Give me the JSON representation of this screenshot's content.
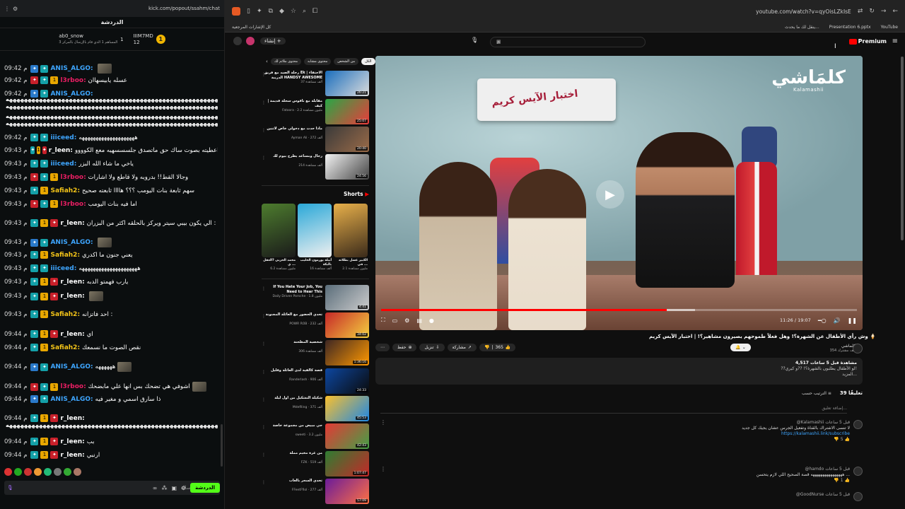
{
  "kick": {
    "url": "kick.com/popout/ssahm/chat",
    "header": "الدردشة",
    "leaders": [
      {
        "name": "IIIM7MD",
        "sub": "12",
        "coin": "1"
      },
      {
        "name": "ab0_snow",
        "sub": "1",
        "note": "المساهم 1 الذي قام بالإرسال بالمركز 3"
      }
    ],
    "messages": [
      {
        "time": "09:42 م",
        "user": "ANIS_ALGO:",
        "color": "#3ea6ff",
        "text": ""
      },
      {
        "time": "09:42 م",
        "user": "l3rboo:",
        "color": "#e91e63",
        "text": "عسله يابيسهاان"
      },
      {
        "time": "09:42 م",
        "user": "ANIS_ALGO:",
        "color": "#3ea6ff",
        "text": ""
      },
      {
        "time": "09:42 م",
        "user": "iiiceed:",
        "color": "#3ea6ff",
        "text": "ههههههههههههههههههههه"
      },
      {
        "time": "09:43 م",
        "user": "r_leen:",
        "color": "#ffffff",
        "text": "اعطيته بصوت ساك حق ماتصدق جلسسسهيه معع الكوووو"
      },
      {
        "time": "09:43 م",
        "user": "iiiceed:",
        "color": "#3ea6ff",
        "text": "ياخي ما شاء الله البزر"
      },
      {
        "time": "09:43 م",
        "user": "l3rboo:",
        "color": "#e91e63",
        "text": "وجالا القط!! بدروبه ولا قاطع ولا اشارات"
      },
      {
        "time": "09:43 م",
        "user": "Safiah2:",
        "color": "#f5c518",
        "text": "سهم ثابعة بنات اليومب ؟؟؟ هاااا ثابعته صحيح"
      },
      {
        "time": "09:43 م",
        "user": "l3rboo:",
        "color": "#e91e63",
        "text": "اما فيه بنات اليومب"
      },
      {
        "time": "09:43 م",
        "user": "r_leen:",
        "color": "#ffffff",
        "text": "الي يكون بيبي سيتر ويركز بالحلقه اكثر من البزران :"
      },
      {
        "time": "09:43 م",
        "user": "ANIS_ALGO:",
        "color": "#3ea6ff",
        "text": ""
      },
      {
        "time": "09:43 م",
        "user": "Safiah2:",
        "color": "#f5c518",
        "text": "يعني جنون ما اكدري"
      },
      {
        "time": "09:43 م",
        "user": "iiiceed:",
        "color": "#3ea6ff",
        "text": "هههههههههههههههههههههه"
      },
      {
        "time": "09:43 م",
        "user": "r_leen:",
        "color": "#ffffff",
        "text": "يارب فهمتو الدبه"
      },
      {
        "time": "09:43 م",
        "user": "r_leen:",
        "color": "#ffffff",
        "text": ""
      },
      {
        "time": "09:43 م",
        "user": "Safiah2:",
        "color": "#f5c518",
        "text": "احد فاتزانه :"
      },
      {
        "time": "09:44 م",
        "user": "r_leen:",
        "color": "#ffffff",
        "text": "اي"
      },
      {
        "time": "09:44 م",
        "user": "Safiah2:",
        "color": "#f5c518",
        "text": "نقص الصوت ما نسمعك"
      },
      {
        "time": "09:44 م",
        "user": "ANIS_ALGO:",
        "color": "#3ea6ff",
        "text": "ههههههه"
      },
      {
        "time": "09:44 م",
        "user": "l3rboo:",
        "color": "#e91e63",
        "text": "اشوفي هي تضحك بس انها علي مابضحك"
      },
      {
        "time": "09:44 م",
        "user": "ANIS_ALGO:",
        "color": "#3ea6ff",
        "text": "ذا سارق اسمي و مغير فيه"
      },
      {
        "time": "09:44 م",
        "user": "r_leen:",
        "color": "#ffffff",
        "text": ""
      },
      {
        "time": "09:44 م",
        "user": "r_leen:",
        "color": "#ffffff",
        "text": "بب"
      },
      {
        "time": "09:44 م",
        "user": "r_leen:",
        "color": "#ffffff",
        "text": "ارنبي"
      }
    ],
    "long_line": "هههههههههههههههههههههههههههههههههههههههههههههههههههههههههههههههههه",
    "input_placeholder": "إرسال رسالة",
    "send_label": "الدردشة"
  },
  "browser": {
    "url": "youtube.com/watch?v=qyOisLZkIsE",
    "bookmarks_left": "كل الإشارات المرجعية",
    "bookmarks_right": [
      "YouTube",
      "Presentation 6.pptx",
      "ينقل لك ما يحدث..."
    ]
  },
  "youtube": {
    "create_label": "إنشاء",
    "premium_label": "Premium",
    "chips": [
      "الكل",
      "من الشخص",
      "محتوى مشابه",
      "محتوى ملائم لك"
    ],
    "video": {
      "title": "وش رأي الأطفال عن الشهرة؟! وهل فعلاً طموحهم يصيرون مشاهير؟! | اختبار الآيس كريم 🍦",
      "time": "11:26 / 19:07",
      "played": 0.6,
      "channel": "كلماشي",
      "subs": "354 ألف مشترك",
      "likes": "365",
      "actions": [
        "مشاركة",
        "تنزيل",
        "حفظ"
      ],
      "channel_logo_ar": "كلمَاشي",
      "channel_logo_en": "Kalamashii",
      "ac_label": "اختبار الآيس كريم",
      "desc_line1": "4,517 مشاهدة قبل 5 ساعات",
      "desc_line2": "??لو الأطفال يطلبون بالشهرة؟! ??و كيري!",
      "desc_line3": "المزيد..."
    },
    "comments": {
      "count": "39 تعليقًا",
      "sort": "الترتيب حسب",
      "add": "إضافة تعليق...",
      "items": [
        {
          "author": "@Kalamashii قبل 5 ساعات",
          "text": "لا تنسى الاشتراك بالقناة وتفعيل الجرس عشان يجيك كل جديد",
          "link": "https://kalamashii.link/subscribe",
          "likes": "5"
        },
        {
          "author": "@hamdo قبل 5 ساعات",
          "text": "ههههههههههههههههه قصة الصحيح اللي لازم يتحسن ...",
          "likes": "1"
        },
        {
          "author": "@GoodNurse قبل 5 ساعات",
          "text": "",
          "likes": ""
        }
      ]
    },
    "shorts_label": "Shorts",
    "sidebar": [
      {
        "title": "رحلة الصيد مع فريق Ek | الاحتفاء الدريبة HANDSY AWESOME",
        "meta": "37 ألف مشاهدة",
        "dur": "26:21",
        "c1": "#1a6ebd",
        "c2": "#dcdcdc"
      },
      {
        "title": "مقابلة مع ناقوس سحلة قديمة | كيف",
        "meta": "Fatoora · 2.2 مليون مشاهدة",
        "dur": "25:07",
        "c1": "#28a745",
        "c2": "#eb3b3b"
      },
      {
        "title": "ماذا حدث مع دخولي خاص لاثنين",
        "meta": "Ayman Ali · 272 ألف",
        "dur": "20:40",
        "c1": "#3a3a3a",
        "c2": "#9b6b48"
      },
      {
        "title": "رجال ومساعد يطرح بيوم لك",
        "meta": "214 ألف مشاهدة",
        "dur": "24:56",
        "c1": "#f2f2f2",
        "c2": "#444"
      },
      {
        "title": "If You Hate Your Job, You Need to Hear This",
        "meta": "Daily Driven Porsche · 1.8 مليون",
        "dur": "4:41",
        "c1": "#5a6d7a",
        "c2": "#ccc"
      },
      {
        "title": "تحدي الحضور مع العائلة المجنونة",
        "meta": "POWR ROB · 232 ألف",
        "dur": "34:02",
        "c1": "#c62828",
        "c2": "#f4d03f"
      },
      {
        "title": "شخصية المطحنة",
        "meta": "306 ألف مشاهدة",
        "dur": "1:36:16",
        "c1": "#3e2723",
        "c2": "#ff9800"
      },
      {
        "title": "قصة كالفية لدى العائلة وقليل",
        "meta": "Randerlash · 906 ألف",
        "dur": "24:33",
        "c1": "#0d47a1",
        "c2": "#0a0a0a"
      },
      {
        "title": "شكيلة التشكيل من أول ليلة",
        "meta": "Mdefiling · 371 ألف",
        "dur": "45:53",
        "c1": "#fbc02d",
        "c2": "#1e88e5"
      },
      {
        "title": "حي مبيض من مجموعة خاصة",
        "meta": "sweeti · 3.2 مليون",
        "dur": "42:43",
        "c1": "#e53935",
        "c2": "#43a047"
      },
      {
        "title": "من غرة مخيم مملة",
        "meta": "FZK · 519 ألف",
        "dur": "1:07:47",
        "c1": "#2e7d32",
        "c2": "#c62828"
      },
      {
        "title": "تحدي السحر بالعاب",
        "meta": "FFeetFfiol · 277 ألف",
        "dur": "57:09",
        "c1": "#6a1b9a",
        "c2": "#ff7043"
      }
    ],
    "shorts": [
      {
        "title": "الكبير عسل بطلاته في ...",
        "views": "2.1 مليون مشاهدة",
        "c1": "#e8b04a",
        "c2": "#3a2a1a"
      },
      {
        "title": "أبيلة يورمون الحليب بالبكة",
        "views": "16 ألف مشاهدة",
        "c1": "#2aa8d8",
        "c2": "#f0f0f0"
      },
      {
        "title": "محمد الحربي ?العقل ي ...",
        "views": "6.2 مليون مشاهدة",
        "c1": "#4d7c2e",
        "c2": "#1a1a1a"
      }
    ]
  },
  "colors": {
    "kick_green": "#53fc18",
    "yt_red": "#ff0000"
  }
}
